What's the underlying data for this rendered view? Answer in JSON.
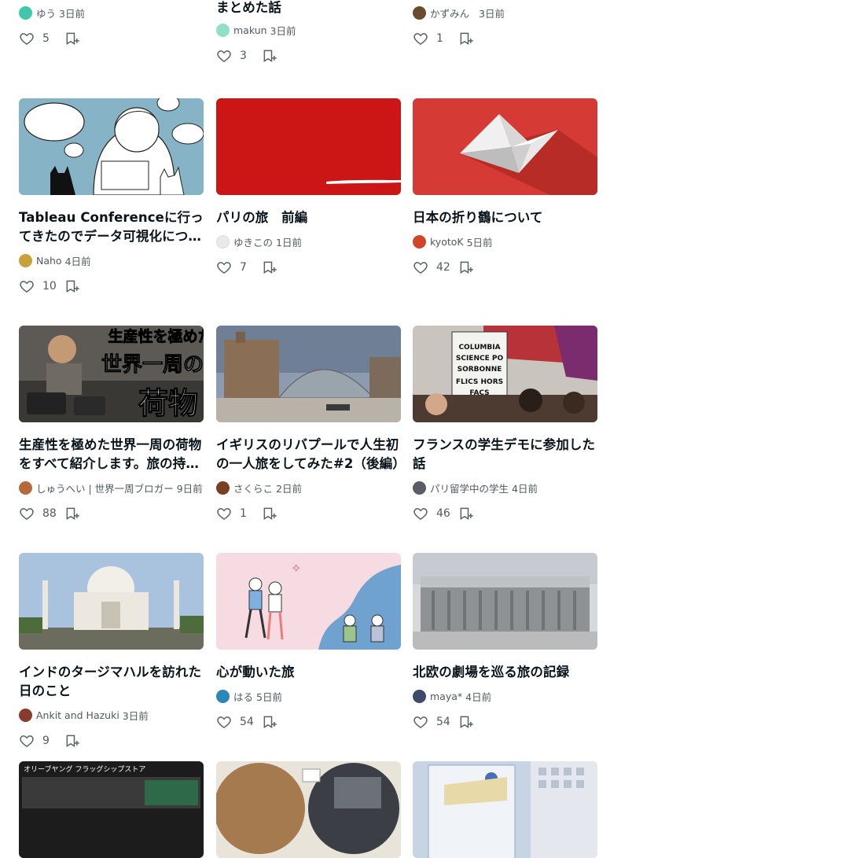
{
  "cards": [
    {
      "title": "",
      "author": "ゆう",
      "age": "3日前",
      "likes": "5",
      "avatar_color": "#3ec8a9"
    },
    {
      "title": "まとめた話",
      "author": "makun",
      "age": "3日前",
      "likes": "3",
      "avatar_color": "#8fe0c8"
    },
    {
      "title": "",
      "author": "かずみん",
      "age": "3日前",
      "likes": "1",
      "avatar_color": "#6b4a2e"
    },
    {
      "title": "Tableau Conferenceに行ってきたのでデータ可視化について色々まとめてみた",
      "author": "Naho",
      "age": "4日前",
      "likes": "10",
      "avatar_color": "#c9a13b"
    },
    {
      "title": "パリの旅　前編",
      "author": "ゆきこの",
      "age": "1日前",
      "likes": "7",
      "avatar_color": "#e6e6e6"
    },
    {
      "title": "日本の折り鶴について",
      "author": "kyotoK",
      "age": "5日前",
      "likes": "42",
      "avatar_color": "#d2452b"
    },
    {
      "title": "生産性を極めた世界一周の荷物をすべて紹介します。旅の持ち物リスト完全版",
      "author": "しゅうへい | 世界一周ブロガー",
      "age": "9日前",
      "likes": "88",
      "avatar_color": "#b66a3a"
    },
    {
      "title": "イギリスのリバプールで人生初の一人旅をしてみた#2（後編）",
      "author": "さくらこ",
      "age": "2日前",
      "likes": "1",
      "avatar_color": "#7a3f23"
    },
    {
      "title": "フランスの学生デモに参加した話",
      "author": "パリ留学中の学生",
      "age": "4日前",
      "likes": "46",
      "avatar_color": "#5c5c66"
    },
    {
      "title": "インドのタージマハルを訪れた日のこと",
      "author": "Ankit and Hazuki",
      "age": "3日前",
      "likes": "9",
      "avatar_color": "#8a3b2f"
    },
    {
      "title": "心が動いた旅",
      "author": "はる",
      "age": "5日前",
      "likes": "54",
      "avatar_color": "#2b87b8"
    },
    {
      "title": "北欧の劇場を巡る旅の記録",
      "author": "maya*",
      "age": "4日前",
      "likes": "54",
      "avatar_color": "#3d4a6a"
    },
    {
      "title": "",
      "author": "",
      "age": "",
      "likes": "",
      "avatar_color": "#cccccc"
    },
    {
      "title": "",
      "author": "",
      "age": "",
      "likes": "",
      "avatar_color": "#cccccc"
    },
    {
      "title": "",
      "author": "",
      "age": "",
      "likes": "",
      "avatar_color": "#cccccc"
    }
  ],
  "thumb_text": {
    "productivity_line1": "生産性を極めた",
    "productivity_line2": "世界一周の",
    "productivity_line3": "荷物",
    "protest_sign": "COLUMBIA SCIENCE PO SORBONNE FLICS HORS FACS",
    "olive_banner": "オリーブヤング フラッグシップストア"
  },
  "colors": {
    "accent_red": "#cc1515",
    "crane_red": "#d63a34",
    "sky_blue": "#86b3c5",
    "pink_bg": "#f6dbe3",
    "muted_text": "#50595e"
  }
}
